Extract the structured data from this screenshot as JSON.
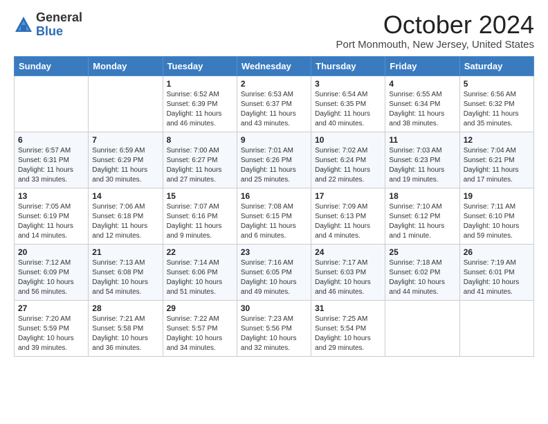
{
  "logo": {
    "general": "General",
    "blue": "Blue"
  },
  "header": {
    "month": "October 2024",
    "location": "Port Monmouth, New Jersey, United States"
  },
  "weekdays": [
    "Sunday",
    "Monday",
    "Tuesday",
    "Wednesday",
    "Thursday",
    "Friday",
    "Saturday"
  ],
  "weeks": [
    [
      {
        "day": "",
        "lines": []
      },
      {
        "day": "",
        "lines": []
      },
      {
        "day": "1",
        "lines": [
          "Sunrise: 6:52 AM",
          "Sunset: 6:39 PM",
          "Daylight: 11 hours",
          "and 46 minutes."
        ]
      },
      {
        "day": "2",
        "lines": [
          "Sunrise: 6:53 AM",
          "Sunset: 6:37 PM",
          "Daylight: 11 hours",
          "and 43 minutes."
        ]
      },
      {
        "day": "3",
        "lines": [
          "Sunrise: 6:54 AM",
          "Sunset: 6:35 PM",
          "Daylight: 11 hours",
          "and 40 minutes."
        ]
      },
      {
        "day": "4",
        "lines": [
          "Sunrise: 6:55 AM",
          "Sunset: 6:34 PM",
          "Daylight: 11 hours",
          "and 38 minutes."
        ]
      },
      {
        "day": "5",
        "lines": [
          "Sunrise: 6:56 AM",
          "Sunset: 6:32 PM",
          "Daylight: 11 hours",
          "and 35 minutes."
        ]
      }
    ],
    [
      {
        "day": "6",
        "lines": [
          "Sunrise: 6:57 AM",
          "Sunset: 6:31 PM",
          "Daylight: 11 hours",
          "and 33 minutes."
        ]
      },
      {
        "day": "7",
        "lines": [
          "Sunrise: 6:59 AM",
          "Sunset: 6:29 PM",
          "Daylight: 11 hours",
          "and 30 minutes."
        ]
      },
      {
        "day": "8",
        "lines": [
          "Sunrise: 7:00 AM",
          "Sunset: 6:27 PM",
          "Daylight: 11 hours",
          "and 27 minutes."
        ]
      },
      {
        "day": "9",
        "lines": [
          "Sunrise: 7:01 AM",
          "Sunset: 6:26 PM",
          "Daylight: 11 hours",
          "and 25 minutes."
        ]
      },
      {
        "day": "10",
        "lines": [
          "Sunrise: 7:02 AM",
          "Sunset: 6:24 PM",
          "Daylight: 11 hours",
          "and 22 minutes."
        ]
      },
      {
        "day": "11",
        "lines": [
          "Sunrise: 7:03 AM",
          "Sunset: 6:23 PM",
          "Daylight: 11 hours",
          "and 19 minutes."
        ]
      },
      {
        "day": "12",
        "lines": [
          "Sunrise: 7:04 AM",
          "Sunset: 6:21 PM",
          "Daylight: 11 hours",
          "and 17 minutes."
        ]
      }
    ],
    [
      {
        "day": "13",
        "lines": [
          "Sunrise: 7:05 AM",
          "Sunset: 6:19 PM",
          "Daylight: 11 hours",
          "and 14 minutes."
        ]
      },
      {
        "day": "14",
        "lines": [
          "Sunrise: 7:06 AM",
          "Sunset: 6:18 PM",
          "Daylight: 11 hours",
          "and 12 minutes."
        ]
      },
      {
        "day": "15",
        "lines": [
          "Sunrise: 7:07 AM",
          "Sunset: 6:16 PM",
          "Daylight: 11 hours",
          "and 9 minutes."
        ]
      },
      {
        "day": "16",
        "lines": [
          "Sunrise: 7:08 AM",
          "Sunset: 6:15 PM",
          "Daylight: 11 hours",
          "and 6 minutes."
        ]
      },
      {
        "day": "17",
        "lines": [
          "Sunrise: 7:09 AM",
          "Sunset: 6:13 PM",
          "Daylight: 11 hours",
          "and 4 minutes."
        ]
      },
      {
        "day": "18",
        "lines": [
          "Sunrise: 7:10 AM",
          "Sunset: 6:12 PM",
          "Daylight: 11 hours",
          "and 1 minute."
        ]
      },
      {
        "day": "19",
        "lines": [
          "Sunrise: 7:11 AM",
          "Sunset: 6:10 PM",
          "Daylight: 10 hours",
          "and 59 minutes."
        ]
      }
    ],
    [
      {
        "day": "20",
        "lines": [
          "Sunrise: 7:12 AM",
          "Sunset: 6:09 PM",
          "Daylight: 10 hours",
          "and 56 minutes."
        ]
      },
      {
        "day": "21",
        "lines": [
          "Sunrise: 7:13 AM",
          "Sunset: 6:08 PM",
          "Daylight: 10 hours",
          "and 54 minutes."
        ]
      },
      {
        "day": "22",
        "lines": [
          "Sunrise: 7:14 AM",
          "Sunset: 6:06 PM",
          "Daylight: 10 hours",
          "and 51 minutes."
        ]
      },
      {
        "day": "23",
        "lines": [
          "Sunrise: 7:16 AM",
          "Sunset: 6:05 PM",
          "Daylight: 10 hours",
          "and 49 minutes."
        ]
      },
      {
        "day": "24",
        "lines": [
          "Sunrise: 7:17 AM",
          "Sunset: 6:03 PM",
          "Daylight: 10 hours",
          "and 46 minutes."
        ]
      },
      {
        "day": "25",
        "lines": [
          "Sunrise: 7:18 AM",
          "Sunset: 6:02 PM",
          "Daylight: 10 hours",
          "and 44 minutes."
        ]
      },
      {
        "day": "26",
        "lines": [
          "Sunrise: 7:19 AM",
          "Sunset: 6:01 PM",
          "Daylight: 10 hours",
          "and 41 minutes."
        ]
      }
    ],
    [
      {
        "day": "27",
        "lines": [
          "Sunrise: 7:20 AM",
          "Sunset: 5:59 PM",
          "Daylight: 10 hours",
          "and 39 minutes."
        ]
      },
      {
        "day": "28",
        "lines": [
          "Sunrise: 7:21 AM",
          "Sunset: 5:58 PM",
          "Daylight: 10 hours",
          "and 36 minutes."
        ]
      },
      {
        "day": "29",
        "lines": [
          "Sunrise: 7:22 AM",
          "Sunset: 5:57 PM",
          "Daylight: 10 hours",
          "and 34 minutes."
        ]
      },
      {
        "day": "30",
        "lines": [
          "Sunrise: 7:23 AM",
          "Sunset: 5:56 PM",
          "Daylight: 10 hours",
          "and 32 minutes."
        ]
      },
      {
        "day": "31",
        "lines": [
          "Sunrise: 7:25 AM",
          "Sunset: 5:54 PM",
          "Daylight: 10 hours",
          "and 29 minutes."
        ]
      },
      {
        "day": "",
        "lines": []
      },
      {
        "day": "",
        "lines": []
      }
    ]
  ]
}
